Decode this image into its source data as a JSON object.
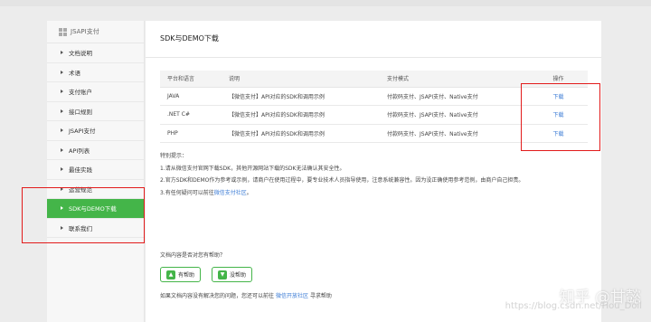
{
  "sidebar": {
    "header": "JSAPI支付",
    "items": [
      {
        "label": "文档说明",
        "active": false
      },
      {
        "label": "术语",
        "active": false
      },
      {
        "label": "支付账户",
        "active": false
      },
      {
        "label": "接口规则",
        "active": false
      },
      {
        "label": "JSAPI支付",
        "active": false
      },
      {
        "label": "API列表",
        "active": false
      },
      {
        "label": "最佳实践",
        "active": false
      },
      {
        "label": "运营规范",
        "active": false
      },
      {
        "label": "SDK与DEMO下载",
        "active": true
      },
      {
        "label": "联系我们",
        "active": false
      }
    ]
  },
  "main": {
    "title": "SDK与DEMO下载",
    "table": {
      "headers": [
        "平台和语言",
        "说明",
        "支付模式",
        "操作"
      ],
      "rows": [
        [
          "JAVA",
          "【微信支付】API对应的SDK和调用示例",
          "付款码支付、JSAPI支付、Native支付",
          "下载"
        ],
        [
          ".NET C#",
          "【微信支付】API对应的SDK和调用示例",
          "付款码支付、JSAPI支付、Native支付",
          "下载"
        ],
        [
          "PHP",
          "【微信支付】API对应的SDK和调用示例",
          "付款码支付、JSAPI支付、Native支付",
          "下载"
        ]
      ]
    },
    "notes": {
      "title": "特别提示：",
      "line1": "1.请从微信支付官网下载SDK，其他开源网站下载的SDK无法确认其安全性。",
      "line2": "2.官方SDK和DEMO作为参考或示例，请商户在使用过程中，要专业技术人员指导使用，注意系统兼容性。因为没正确使用参考范例，由商户自己担责。",
      "line3_prefix": "3.有任何疑问可以前往",
      "line3_link": "微信支付社区",
      "line3_suffix": "。"
    },
    "help_question": "文档内容是否对您有帮助？",
    "helpful_button": "有帮助",
    "not_helpful_button": "没帮助",
    "footer_prefix": "如果文档内容没有解决您的问题，您还可以前往",
    "footer_link": "微信开放社区",
    "footer_suffix": "寻求帮助"
  },
  "watermark": {
    "main": "知乎 @甘懿",
    "url": "https://blog.csdn.net/Hou_Doil"
  },
  "colors": {
    "accent_green": "#44b549",
    "link_blue": "#3a7bd5",
    "highlight_red": "#e21b1b"
  }
}
